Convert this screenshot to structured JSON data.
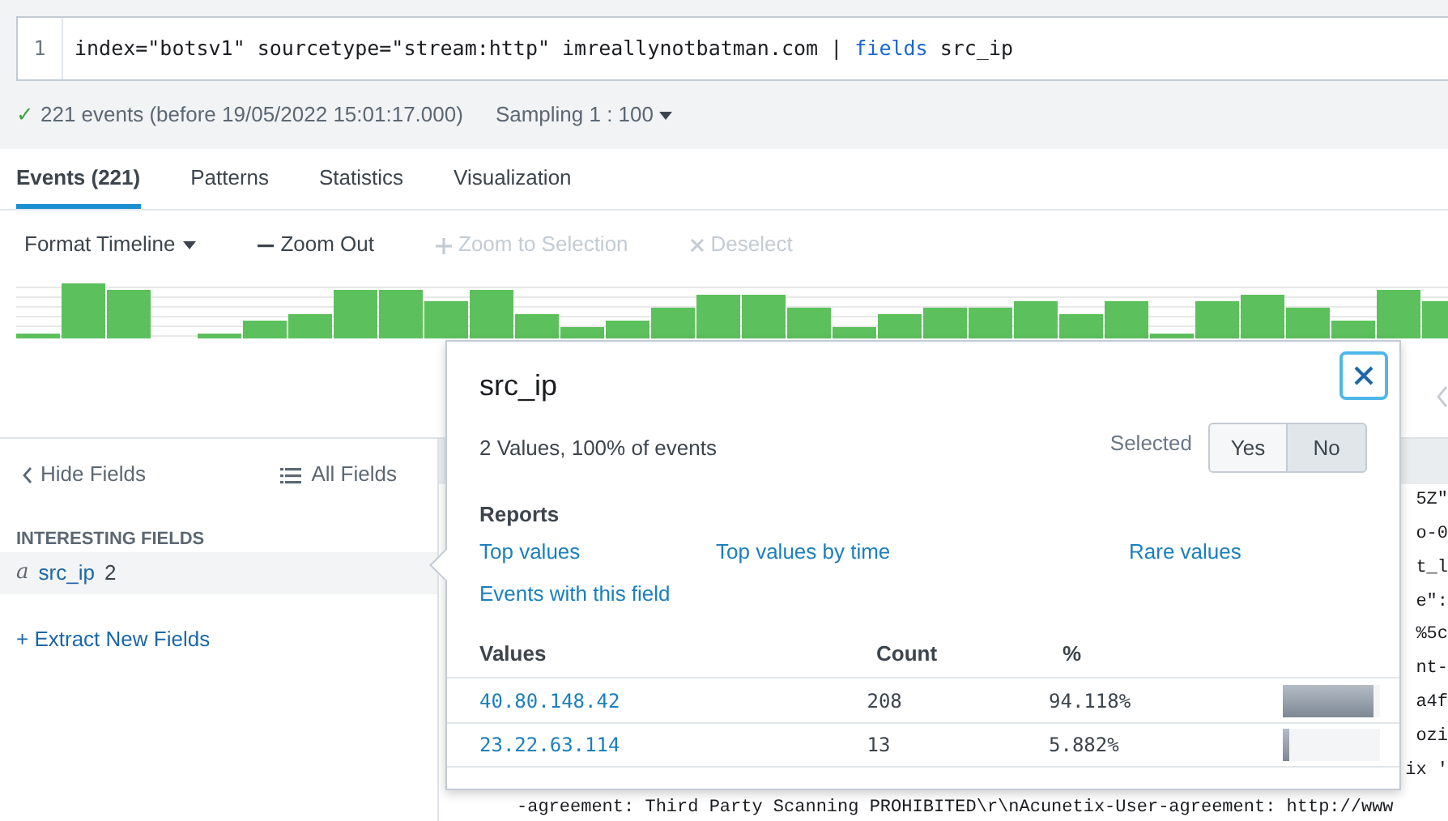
{
  "search": {
    "line_number": "1",
    "query_parts": [
      {
        "kind": "plain",
        "text": "index=\"botsv1\" sourcetype=\"stream:http\" imreallynotbatman.com |"
      },
      {
        "kind": "command",
        "text": "fields"
      },
      {
        "kind": "plain",
        "text": "src_ip"
      }
    ]
  },
  "status": {
    "check": "✓",
    "summary": "221 events (before 19/05/2022 15:01:17.000)",
    "sampling": "Sampling 1 : 100"
  },
  "tabs": [
    {
      "label": "Events (221)",
      "selected": true
    },
    {
      "label": "Patterns",
      "selected": false
    },
    {
      "label": "Statistics",
      "selected": false
    },
    {
      "label": "Visualization",
      "selected": false
    }
  ],
  "timeline_toolbar": [
    {
      "kind": "menu",
      "label": "Format Timeline",
      "disabled": false
    },
    {
      "kind": "minus",
      "label": "Zoom Out",
      "disabled": false
    },
    {
      "kind": "plus",
      "label": "Zoom to Selection",
      "disabled": true
    },
    {
      "kind": "times",
      "label": "Deselect",
      "disabled": true
    }
  ],
  "sidebar": {
    "hide_fields": "Hide Fields",
    "all_fields": "All Fields",
    "section": "INTERESTING FIELDS",
    "fields": [
      {
        "type_mark": "a",
        "name": "src_ip",
        "count": "2",
        "selected": true
      }
    ],
    "extract": "+ Extract New Fields"
  },
  "events": {
    "fragments": [
      "5Z\"",
      "o-0",
      "t_l",
      "e\":",
      "%5c",
      "nt-",
      "a4f",
      "ozi",
      "ix '"
    ],
    "last_line": "-agreement: Third Party Scanning PROHIBITED\\r\\nAcunetix-User-agreement: http://www"
  },
  "popup": {
    "title": "src_ip",
    "summary": "2 Values, 100% of events",
    "selected_label": "Selected",
    "toggle": [
      {
        "label": "Yes",
        "selected": false
      },
      {
        "label": "No",
        "selected": true
      }
    ],
    "reports_title": "Reports",
    "reports": [
      "Top values",
      "Top values by time",
      "Rare values",
      "Events with this field"
    ],
    "columns": [
      "Values",
      "Count",
      "%"
    ],
    "rows": [
      {
        "value": "40.80.148.42",
        "count": "208",
        "percent": "94.118%",
        "level": 0.94118
      },
      {
        "value": "23.22.63.114",
        "count": "13",
        "percent": "5.882%",
        "level": 0.05882
      }
    ]
  }
}
